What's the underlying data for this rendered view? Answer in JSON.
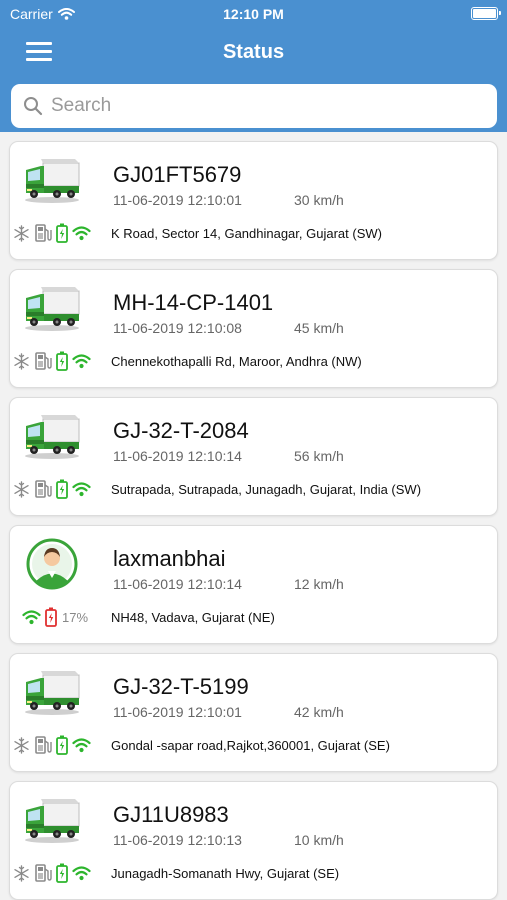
{
  "status_bar": {
    "carrier": "Carrier",
    "time": "12:10 PM"
  },
  "nav": {
    "title": "Status"
  },
  "search": {
    "placeholder": "Search"
  },
  "vehicles": [
    {
      "type": "truck",
      "name": "GJ01FT5679",
      "datetime": "11-06-2019 12:10:01",
      "speed": "30 km/h",
      "address": "K Road, Sector 14, Gandhinagar, Gujarat (SW)"
    },
    {
      "type": "truck",
      "name": "MH-14-CP-1401",
      "datetime": "11-06-2019 12:10:08",
      "speed": "45 km/h",
      "address": "Chennekothapalli Rd, Maroor, Andhra (NW)"
    },
    {
      "type": "truck",
      "name": "GJ-32-T-2084",
      "datetime": "11-06-2019 12:10:14",
      "speed": "56 km/h",
      "address": "Sutrapada, Sutrapada, Junagadh, Gujarat, India (SW)"
    },
    {
      "type": "person",
      "name": "laxmanbhai",
      "datetime": "11-06-2019 12:10:14",
      "speed": "12 km/h",
      "address": "NH48, Vadava, Gujarat (NE)",
      "battery": "17%"
    },
    {
      "type": "truck",
      "name": "GJ-32-T-5199",
      "datetime": "11-06-2019 12:10:01",
      "speed": "42 km/h",
      "address": "Gondal -sapar road,Rajkot,360001, Gujarat (SE)"
    },
    {
      "type": "truck",
      "name": "GJ11U8983",
      "datetime": "11-06-2019 12:10:13",
      "speed": "10 km/h",
      "address": "Junagadh-Somanath Hwy, Gujarat (SE)"
    }
  ],
  "colors": {
    "header": "#4a90d0",
    "ok_green": "#2db52d",
    "warn_red": "#e03030",
    "truck_green": "#3aa43a"
  },
  "icons": {
    "truck": "truck-icon",
    "person": "person-avatar-icon",
    "ac": "snowflake-icon",
    "fuel": "fuel-pump-icon",
    "battery": "battery-icon",
    "signal": "wifi-signal-icon"
  }
}
